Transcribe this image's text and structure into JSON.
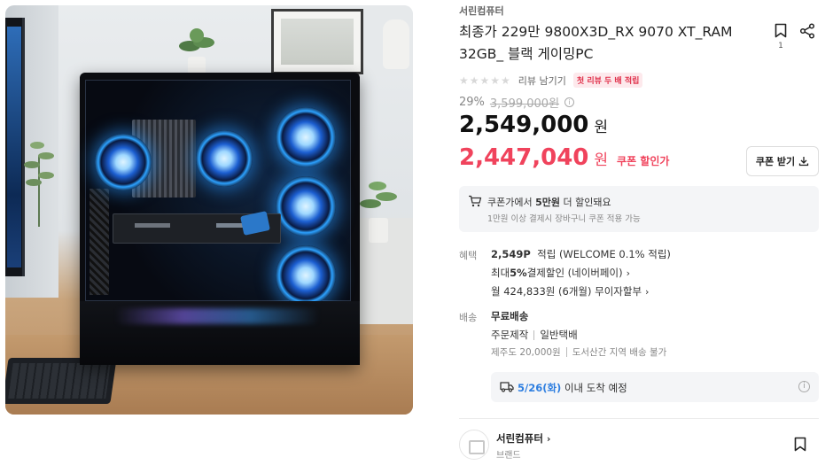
{
  "product": {
    "brand": "서린컴퓨터",
    "title": "최종가 229만 9800X3D_RX 9070 XT_RAM 32GB_ 블랙 게이밍PC",
    "bookmark_count": "1",
    "image_icon": "gaming-pc-photo"
  },
  "rating": {
    "stars": "★★★★★",
    "review_link": "리뷰 남기기",
    "badge": "첫 리뷰 두 배 적립"
  },
  "pricing": {
    "discount_pct": "29%",
    "original_price": "3,599,000원",
    "price": "2,549,000",
    "price_unit": "원",
    "coupon_price": "2,447,040",
    "coupon_price_unit": "원",
    "coupon_label": "쿠폰 할인가",
    "coupon_button": "쿠폰 받기"
  },
  "coupon_notice": {
    "prefix": "쿠폰가에서 ",
    "highlight": "5만원",
    "suffix": " 더 할인돼요",
    "sub": "1만원 이상 결제시 장바구니 쿠폰 적용 가능"
  },
  "benefits": {
    "label": "혜택",
    "points_bold": "2,549P",
    "points_rest": "적립 (WELCOME 0.1% 적립)",
    "discount_prefix": "최대 ",
    "discount_bold": "5%",
    "discount_rest": " 결제할인 (네이버페이)",
    "installment": "월 424,833원 (6개월) 무이자할부"
  },
  "shipping": {
    "label": "배송",
    "fee": "무료배송",
    "type1": "주문제작",
    "type2": "일반택배",
    "extra1": "제주도 20,000원",
    "extra2": "도서산간 지역 배송 불가",
    "arrival_date": "5/26(화)",
    "arrival_rest": " 이내 도착 예정"
  },
  "store": {
    "name": "서린컴퓨터",
    "type": "브랜드"
  },
  "icons": {
    "bookmark": "bookmark-icon",
    "share": "share-icon",
    "info": "info-icon",
    "download": "download-icon",
    "cart": "cart-icon",
    "truck": "truck-icon",
    "chevron": "chevron-right-icon"
  },
  "colors": {
    "accent_red": "#f0435c",
    "delivery_blue": "#2f7fe0",
    "muted": "#888888"
  }
}
